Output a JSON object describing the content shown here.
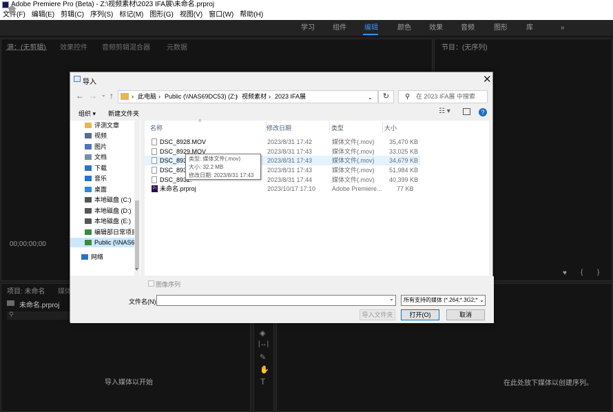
{
  "window": {
    "title": "Adobe Premiere Pro (Beta) - Z:\\视频素材\\2023 IFA展\\未命名.prproj"
  },
  "menu": [
    "文件(F)",
    "编辑(E)",
    "剪辑(C)",
    "序列(S)",
    "标记(M)",
    "图形(G)",
    "视图(V)",
    "窗口(W)",
    "帮助(H)"
  ],
  "workspaces": [
    "学习",
    "组件",
    "编辑",
    "颜色",
    "效果",
    "音频",
    "图形",
    "库"
  ],
  "workspace_more": "»",
  "panels": {
    "source_tabs": [
      "源：(无剪辑)",
      "效果控件",
      "音频剪辑混合器",
      "元数据"
    ],
    "program_tab": "节目：(无序列)",
    "timecode": "00;00;00;00",
    "project_tab": "项目: 未命名",
    "project_second_tab": "媒体",
    "project_file": "未命名.prproj",
    "import_hint": "导入媒体以开始",
    "timeline_hint": "在此处放下媒体以创建序列。"
  },
  "dialog": {
    "title": "导入",
    "breadcrumb": [
      "此电脑",
      "Public (\\\\NAS69DC53) (Z:)",
      "视频素材",
      "2023 IFA展"
    ],
    "search_placeholder": "在 2023 IFA展 中搜索",
    "organize": "组织 ▾",
    "new_folder": "新建文件夹",
    "sidebar": [
      {
        "label": "评测文章",
        "icon": "folder-icon",
        "color": "#e8b84a"
      },
      {
        "label": "视频",
        "icon": "video-icon",
        "color": "#5a6b8c"
      },
      {
        "label": "图片",
        "icon": "picture-icon",
        "color": "#4f74b8"
      },
      {
        "label": "文档",
        "icon": "document-icon",
        "color": "#7b8ea8"
      },
      {
        "label": "下载",
        "icon": "download-icon",
        "color": "#2a72c8"
      },
      {
        "label": "音乐",
        "icon": "music-icon",
        "color": "#2a72c8"
      },
      {
        "label": "桌面",
        "icon": "desktop-icon",
        "color": "#2a8ad8"
      },
      {
        "label": "本地磁盘 (C:)",
        "icon": "drive-icon",
        "color": "#555555"
      },
      {
        "label": "本地磁盘 (D:)",
        "icon": "drive-icon",
        "color": "#555555"
      },
      {
        "label": "本地磁盘 (E:)",
        "icon": "drive-icon",
        "color": "#555555"
      },
      {
        "label": "编辑部日常项目",
        "icon": "network-drive-icon",
        "color": "#3a8a3a"
      },
      {
        "label": "Public (\\\\NAS6",
        "icon": "network-drive-icon",
        "color": "#3a8a3a"
      },
      {
        "label": "网络",
        "icon": "network-icon",
        "color": "#2a72c8"
      }
    ],
    "columns": [
      "名称",
      "修改日期",
      "类型",
      "大小"
    ],
    "files": [
      {
        "name": "DSC_8928.MOV",
        "date": "2023/8/31 17:42",
        "type": "媒体文件(.mov)",
        "size": "35,470 KB"
      },
      {
        "name": "DSC_8929.MOV",
        "date": "2023/8/31 17:43",
        "type": "媒体文件(.mov)",
        "size": "33,025 KB"
      },
      {
        "name": "DSC_8930.",
        "date": "2023/8/31 17:43",
        "type": "媒体文件(.mov)",
        "size": "34,679 KB"
      },
      {
        "name": "DSC_8931.",
        "date": "2023/8/31 17:43",
        "type": "媒体文件(.mov)",
        "size": "51,984 KB"
      },
      {
        "name": "DSC_8932.",
        "date": "2023/8/31 17:44",
        "type": "媒体文件(.mov)",
        "size": "40,399 KB"
      },
      {
        "name": "未命名.prproj",
        "date": "2023/10/17 17:10",
        "type": "Adobe Premiere...",
        "size": "77 KB"
      }
    ],
    "tooltip": [
      "类型: 媒体文件(.mov)",
      "大小: 32.2 MB",
      "修改日期: 2023/8/31 17:43"
    ],
    "image_sequence_label": "图像序列",
    "filename_label": "文件名(N):",
    "filename_value": "",
    "filter": "所有支持的媒体 (*.264;*.3G2;*",
    "import_folder_button": "导入文件夹",
    "open_button": "打开(O)",
    "cancel_button": "取消"
  }
}
